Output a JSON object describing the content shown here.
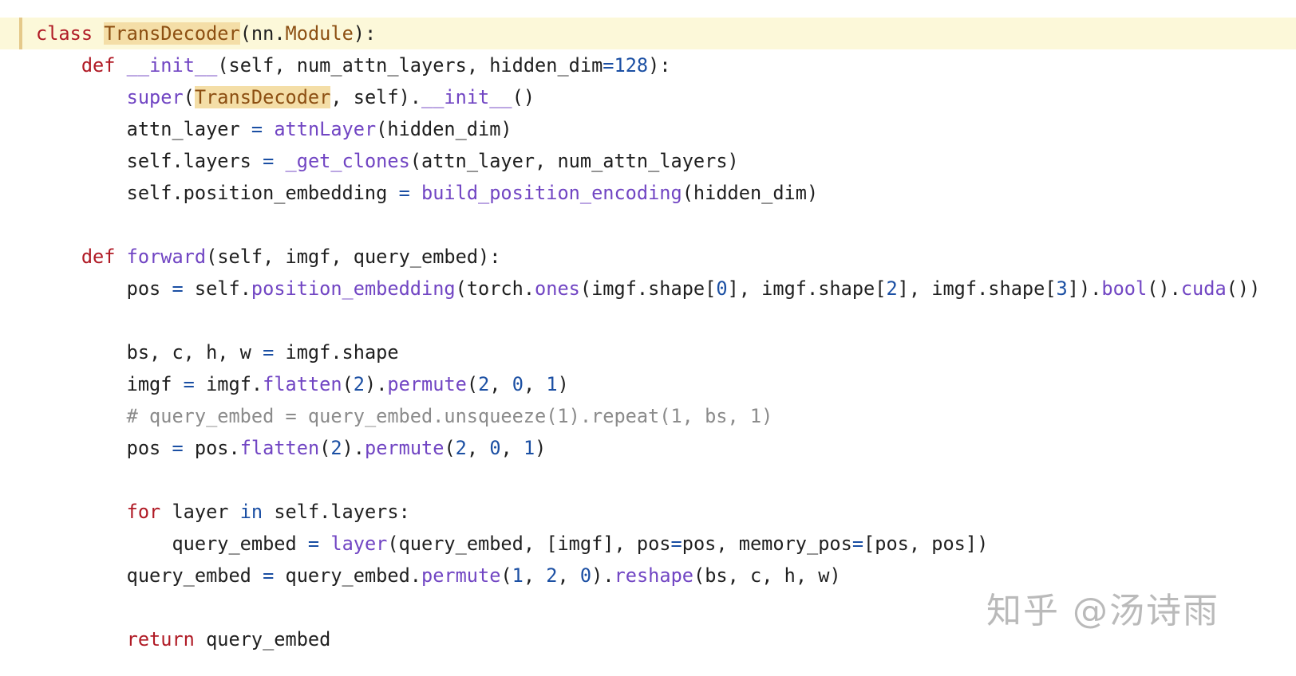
{
  "colors": {
    "keyword": "#b01a25",
    "function": "#7145c3",
    "number": "#1b4fa3",
    "class_name": "#8c4f12",
    "highlight": "#f4dea7",
    "current_line": "#fcf8d9",
    "comment": "#8b8b8b",
    "text": "#1f1f1f"
  },
  "lines": [
    {
      "current": true,
      "tokens": [
        {
          "t": "class",
          "c": "kw"
        },
        {
          "t": " "
        },
        {
          "t": "TransDecoder",
          "c": "cls hl"
        },
        {
          "t": "(nn."
        },
        {
          "t": "Module",
          "c": "cls"
        },
        {
          "t": "):"
        }
      ]
    },
    {
      "tokens": [
        {
          "t": "    "
        },
        {
          "t": "def",
          "c": "kw"
        },
        {
          "t": " "
        },
        {
          "t": "__init__",
          "c": "fn"
        },
        {
          "t": "(self, num_attn_layers, hidden_dim"
        },
        {
          "t": "=",
          "c": "op"
        },
        {
          "t": "128",
          "c": "num"
        },
        {
          "t": "):"
        }
      ]
    },
    {
      "tokens": [
        {
          "t": "        "
        },
        {
          "t": "super",
          "c": "fn"
        },
        {
          "t": "("
        },
        {
          "t": "TransDecoder",
          "c": "cls hl"
        },
        {
          "t": ", self)."
        },
        {
          "t": "__init__",
          "c": "fn"
        },
        {
          "t": "()"
        }
      ]
    },
    {
      "tokens": [
        {
          "t": "        attn_layer "
        },
        {
          "t": "=",
          "c": "op"
        },
        {
          "t": " "
        },
        {
          "t": "attnLayer",
          "c": "fn"
        },
        {
          "t": "(hidden_dim)"
        }
      ]
    },
    {
      "tokens": [
        {
          "t": "        self.layers "
        },
        {
          "t": "=",
          "c": "op"
        },
        {
          "t": " "
        },
        {
          "t": "_get_clones",
          "c": "fn"
        },
        {
          "t": "(attn_layer, num_attn_layers)"
        }
      ]
    },
    {
      "tokens": [
        {
          "t": "        self.position_embedding "
        },
        {
          "t": "=",
          "c": "op"
        },
        {
          "t": " "
        },
        {
          "t": "build_position_encoding",
          "c": "fn"
        },
        {
          "t": "(hidden_dim)"
        }
      ]
    },
    {
      "tokens": []
    },
    {
      "tokens": [
        {
          "t": "    "
        },
        {
          "t": "def",
          "c": "kw"
        },
        {
          "t": " "
        },
        {
          "t": "forward",
          "c": "fn"
        },
        {
          "t": "(self, imgf, query_embed):"
        }
      ]
    },
    {
      "tokens": [
        {
          "t": "        pos "
        },
        {
          "t": "=",
          "c": "op"
        },
        {
          "t": " self."
        },
        {
          "t": "position_embedding",
          "c": "fn"
        },
        {
          "t": "(torch."
        },
        {
          "t": "ones",
          "c": "fn"
        },
        {
          "t": "(imgf.shape["
        },
        {
          "t": "0",
          "c": "num"
        },
        {
          "t": "], imgf.shape["
        },
        {
          "t": "2",
          "c": "num"
        },
        {
          "t": "], imgf.shape["
        },
        {
          "t": "3",
          "c": "num"
        },
        {
          "t": "])."
        },
        {
          "t": "bool",
          "c": "fn"
        },
        {
          "t": "()."
        },
        {
          "t": "cuda",
          "c": "fn"
        },
        {
          "t": "())"
        }
      ]
    },
    {
      "tokens": []
    },
    {
      "tokens": [
        {
          "t": "        bs, c, h, w "
        },
        {
          "t": "=",
          "c": "op"
        },
        {
          "t": " imgf.shape"
        }
      ]
    },
    {
      "tokens": [
        {
          "t": "        imgf "
        },
        {
          "t": "=",
          "c": "op"
        },
        {
          "t": " imgf."
        },
        {
          "t": "flatten",
          "c": "fn"
        },
        {
          "t": "("
        },
        {
          "t": "2",
          "c": "num"
        },
        {
          "t": ")."
        },
        {
          "t": "permute",
          "c": "fn"
        },
        {
          "t": "("
        },
        {
          "t": "2",
          "c": "num"
        },
        {
          "t": ", "
        },
        {
          "t": "0",
          "c": "num"
        },
        {
          "t": ", "
        },
        {
          "t": "1",
          "c": "num"
        },
        {
          "t": ")"
        }
      ]
    },
    {
      "tokens": [
        {
          "t": "        "
        },
        {
          "t": "# query_embed = query_embed.unsqueeze(1).repeat(1, bs, 1)",
          "c": "cmt"
        }
      ]
    },
    {
      "tokens": [
        {
          "t": "        pos "
        },
        {
          "t": "=",
          "c": "op"
        },
        {
          "t": " pos."
        },
        {
          "t": "flatten",
          "c": "fn"
        },
        {
          "t": "("
        },
        {
          "t": "2",
          "c": "num"
        },
        {
          "t": ")."
        },
        {
          "t": "permute",
          "c": "fn"
        },
        {
          "t": "("
        },
        {
          "t": "2",
          "c": "num"
        },
        {
          "t": ", "
        },
        {
          "t": "0",
          "c": "num"
        },
        {
          "t": ", "
        },
        {
          "t": "1",
          "c": "num"
        },
        {
          "t": ")"
        }
      ]
    },
    {
      "tokens": []
    },
    {
      "tokens": [
        {
          "t": "        "
        },
        {
          "t": "for",
          "c": "kw"
        },
        {
          "t": " layer "
        },
        {
          "t": "in",
          "c": "op"
        },
        {
          "t": " self.layers:"
        }
      ]
    },
    {
      "tokens": [
        {
          "t": "            query_embed "
        },
        {
          "t": "=",
          "c": "op"
        },
        {
          "t": " "
        },
        {
          "t": "layer",
          "c": "fn"
        },
        {
          "t": "(query_embed, [imgf], pos"
        },
        {
          "t": "=",
          "c": "op"
        },
        {
          "t": "pos, memory_pos"
        },
        {
          "t": "=",
          "c": "op"
        },
        {
          "t": "[pos, pos])"
        }
      ]
    },
    {
      "tokens": [
        {
          "t": "        query_embed "
        },
        {
          "t": "=",
          "c": "op"
        },
        {
          "t": " query_embed."
        },
        {
          "t": "permute",
          "c": "fn"
        },
        {
          "t": "("
        },
        {
          "t": "1",
          "c": "num"
        },
        {
          "t": ", "
        },
        {
          "t": "2",
          "c": "num"
        },
        {
          "t": ", "
        },
        {
          "t": "0",
          "c": "num"
        },
        {
          "t": ")."
        },
        {
          "t": "reshape",
          "c": "fn"
        },
        {
          "t": "(bs, c, h, w)"
        }
      ]
    },
    {
      "tokens": []
    },
    {
      "tokens": [
        {
          "t": "        "
        },
        {
          "t": "return",
          "c": "kw"
        },
        {
          "t": " query_embed"
        }
      ]
    }
  ],
  "watermark": "知乎 @汤诗雨"
}
